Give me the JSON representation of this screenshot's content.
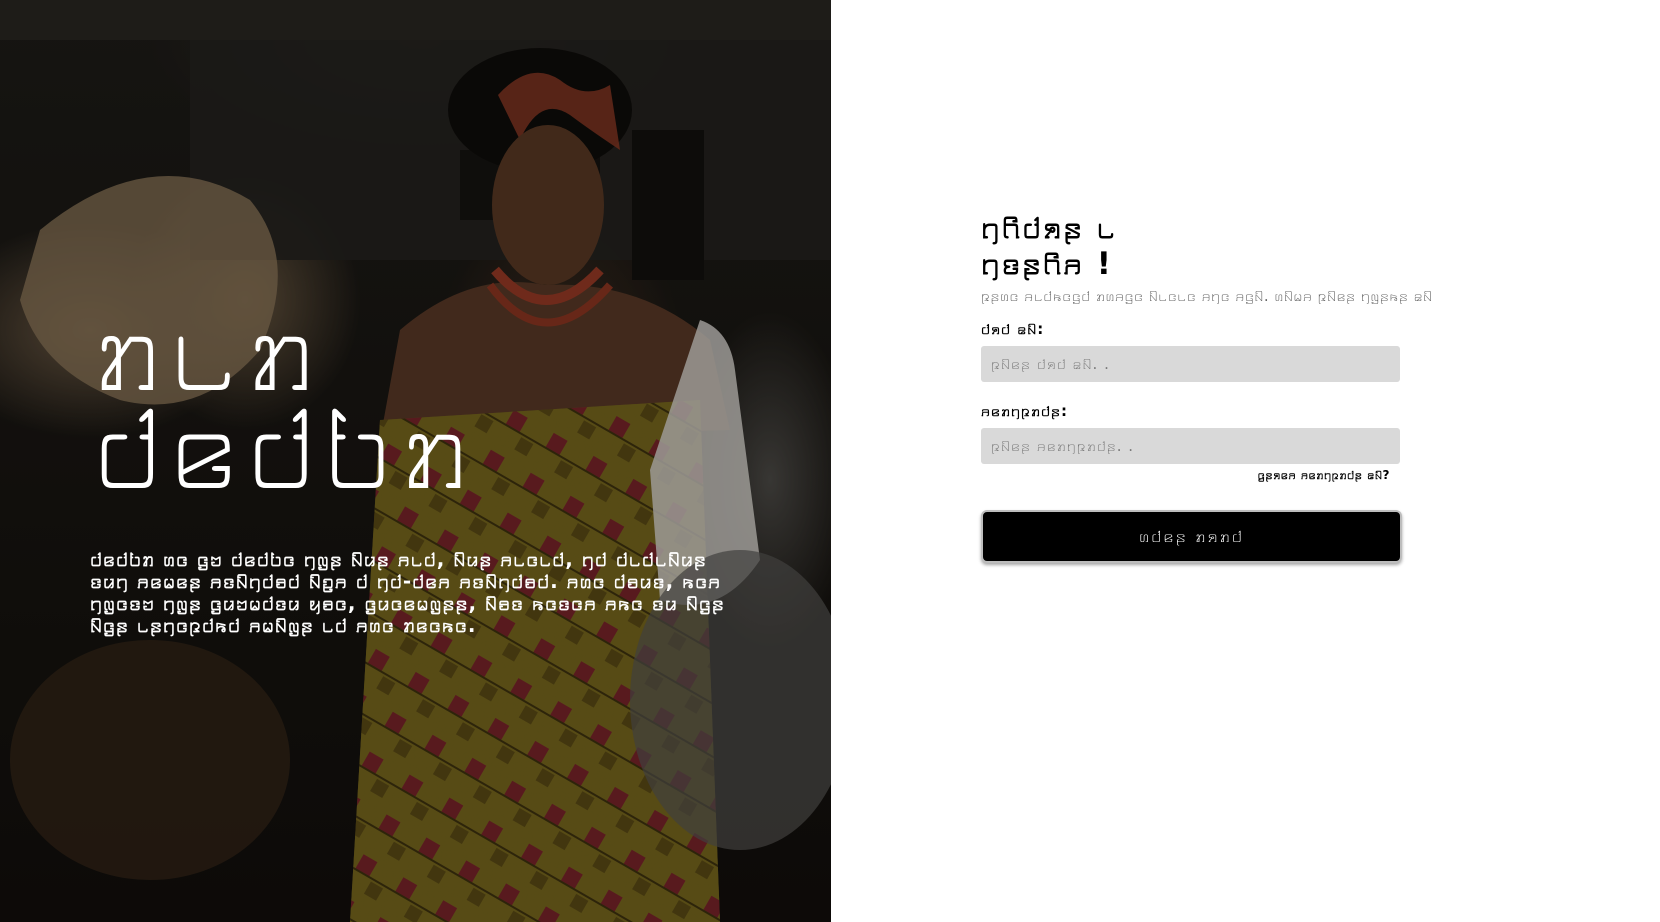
{
  "hero": {
    "title_line1": "ꤊ꤈ꤊ",
    "title_line2": "ꤓꤕꤓꤝꤊ",
    "text": "ꤓꤕꤓꤝꤊ ꤛꤍ ꤞꤠ ꤓꤕꤓꤝꤍ ꤚꤜꤔ ꤡꤣꤔ ꤏ꤈ꤓ, ꤡꤣꤔ ꤏ꤈ꤍ꤈ꤓ, ꤚꤓ ꤓ꤈ꤓ꤈ꤡꤣꤔ ꤢꤣꤚ ꤏꤕꤗꤕꤔ ꤏꤢꤡꤚꤓꤋꤓ ꤡꤑꤏ ꤓ ꤚꤓ-ꤓꤕꤏ ꤏꤢꤡꤚꤓꤋꤓ. ꤏꤛꤍ ꤓꤋꤣꤢ, ꤒꤍꤏ ꤚꤜꤍꤢꤠ ꤚꤜꤔ ꤞꤣꤠꤗꤓꤢꤣ ꤟꤋꤍ, ꤞꤣꤍꤕꤗꤜꤔꤔ, ꤡꤋꤢ ꤒꤍꤢꤍꤏ ꤏꤒꤍ ꤢꤣ ꤡꤞꤔ ꤡꤞꤔ ꤈ꤔꤚꤍꤐꤓꤒꤓ ꤏꤗꤡꤜꤔ ꤈ꤓ ꤏꤛꤍ ꤊꤕꤍꤒꤍ."
  },
  "login": {
    "heading_line1": "ꤚꤖꤓꤎꤔ ꤈",
    "heading_line2": "ꤚꤢꤔꤖꤏ !",
    "subtitle": "ꤐꤔꤛꤍ ꤏ꤈ꤓꤒꤍꤞꤓ ꤊꤛꤏꤞꤍ ꤡ꤈ꤍ꤈ꤍ ꤏꤚꤍ ꤏꤞꤡ. ꤛꤡꤗꤏ ꤐꤡꤕꤔ ꤚꤜꤔꤒꤔ ꤘꤡ",
    "user_label": "ꤓꤎꤓ ꤘꤡ:",
    "user_placeholder": "ꤐꤡꤕꤔ ꤓꤎꤓ ꤘꤡ. .",
    "password_label": "ꤏꤕꤊꤚꤐꤊꤓꤔ:",
    "password_placeholder": "ꤐꤡꤕꤔ ꤏꤕꤊꤚꤐꤊꤓꤔ. .",
    "forgot_text": "ꤞꤔꤎꤕꤏ ꤏꤕꤊꤚꤐꤊꤓꤔ ꤘꤡ?",
    "submit_label": "ꤛꤓꤕꤔ ꤊꤎꤊꤓ"
  },
  "colors": {
    "submit_bg": "#000000",
    "input_bg": "#d9d9d9",
    "subtitle_text": "#666666"
  }
}
